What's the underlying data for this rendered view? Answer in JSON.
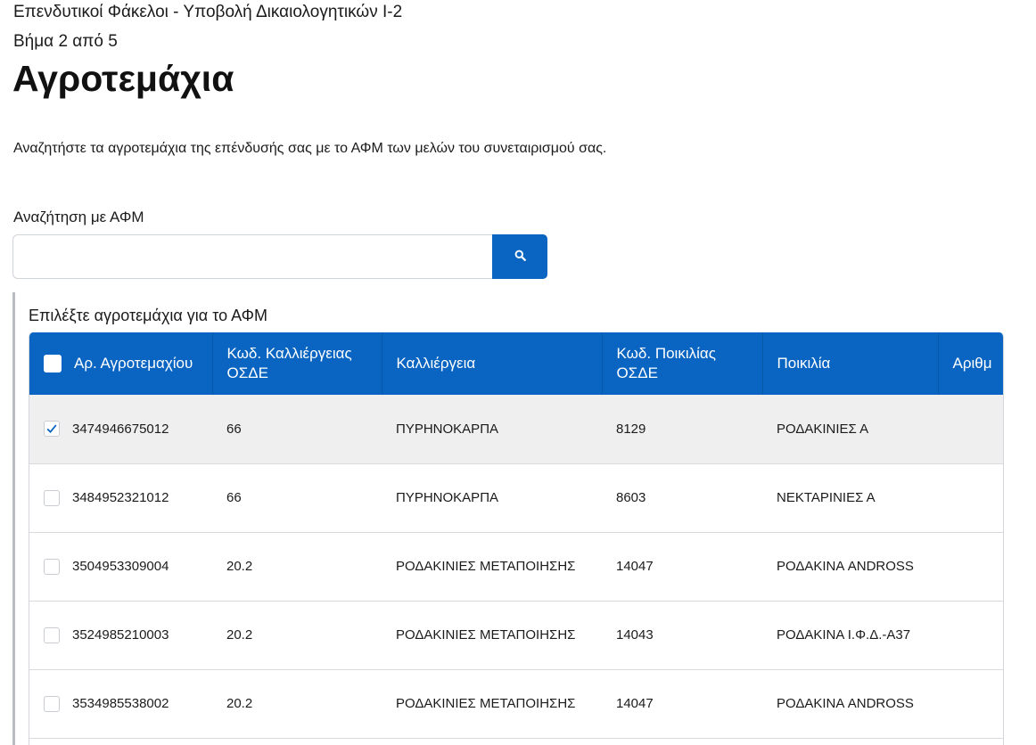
{
  "header": {
    "breadcrumb": "Επενδυτικοί Φάκελοι - Υποβολή Δικαιολογητικών Ι-2",
    "step": "Βήμα 2 από 5",
    "title": "Αγροτεμάχια"
  },
  "intro": "Αναζητήστε τα αγροτεμάχια της επένδυσής σας με το ΑΦΜ των μελών του συνεταιρισμού σας.",
  "search": {
    "label": "Αναζήτηση με ΑΦΜ",
    "value": "",
    "button_icon": "search-icon"
  },
  "selection": {
    "label": "Επιλέξτε αγροτεμάχια για το ΑΦΜ"
  },
  "table": {
    "columns": [
      "Αρ. Αγροτεμαχίου",
      "Κωδ. Καλλιέργειας ΟΣΔΕ",
      "Καλλιέργεια",
      "Κωδ. Ποικιλίας ΟΣΔΕ",
      "Ποικιλία",
      "Αριθμ"
    ],
    "rows": [
      {
        "checked": true,
        "parcel": "3474946675012",
        "crop_code": "66",
        "crop": "ΠΥΡΗΝΟΚΑΡΠΑ",
        "variety_code": "8129",
        "variety": "ΡΟΔΑΚΙΝΙΕΣ Α"
      },
      {
        "checked": false,
        "parcel": "3484952321012",
        "crop_code": "66",
        "crop": "ΠΥΡΗΝΟΚΑΡΠΑ",
        "variety_code": "8603",
        "variety": "ΝΕΚΤΑΡΙΝΙΕΣ Α"
      },
      {
        "checked": false,
        "parcel": "3504953309004",
        "crop_code": "20.2",
        "crop": "ΡΟΔΑΚΙΝΙΕΣ ΜΕΤΑΠΟΙΗΣΗΣ",
        "variety_code": "14047",
        "variety": "ΡΟΔΑΚΙΝΑ ANDROSS"
      },
      {
        "checked": false,
        "parcel": "3524985210003",
        "crop_code": "20.2",
        "crop": "ΡΟΔΑΚΙΝΙΕΣ ΜΕΤΑΠΟΙΗΣΗΣ",
        "variety_code": "14043",
        "variety": "ΡΟΔΑΚΙΝΑ Ι.Φ.Δ.-Α37"
      },
      {
        "checked": false,
        "parcel": "3534985538002",
        "crop_code": "20.2",
        "crop": "ΡΟΔΑΚΙΝΙΕΣ ΜΕΤΑΠΟΙΗΣΗΣ",
        "variety_code": "14047",
        "variety": "ΡΟΔΑΚΙΝΑ ANDROSS"
      }
    ]
  },
  "colors": {
    "primary": "#0965c1",
    "selected_row": "#efefef"
  }
}
